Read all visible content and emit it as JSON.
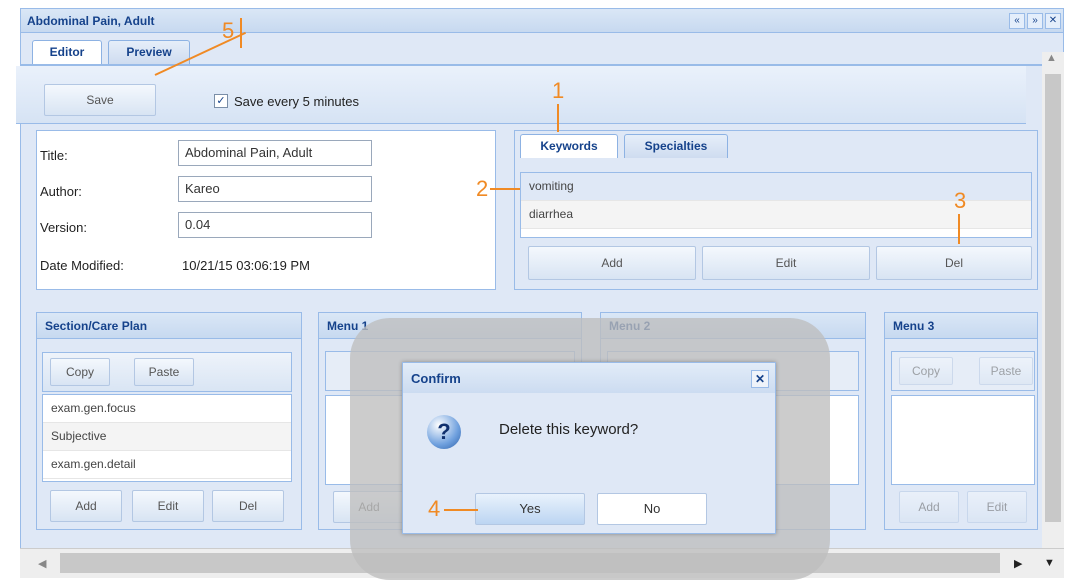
{
  "window": {
    "title": "Abdominal Pain, Adult",
    "tools": [
      "«",
      "»",
      "✕"
    ]
  },
  "tabs": [
    {
      "label": "Editor"
    },
    {
      "label": "Preview"
    }
  ],
  "toolbar": {
    "save_label": "Save",
    "autosave_label": "Save every 5 minutes",
    "autosave_checked": true
  },
  "fields": {
    "title_label": "Title:",
    "title_value": "Abdominal Pain, Adult",
    "author_label": "Author:",
    "author_value": "Kareo",
    "version_label": "Version:",
    "version_value": "0.04",
    "date_label": "Date Modified:",
    "date_value": "10/21/15 03:06:19 PM"
  },
  "keywords": {
    "tabs": [
      "Keywords",
      "Specialties"
    ],
    "items": [
      "vomiting",
      "diarrhea"
    ],
    "buttons": [
      "Add",
      "Edit",
      "Del"
    ]
  },
  "sections": [
    {
      "title": "Section/Care Plan",
      "copy": "Copy",
      "paste": "Paste",
      "items": [
        "exam.gen.focus",
        "Subjective",
        "exam.gen.detail"
      ],
      "buttons": [
        "Add",
        "Edit",
        "Del"
      ]
    },
    {
      "title": "Menu 1",
      "buttons": [
        "Add"
      ]
    },
    {
      "title": "Menu 2"
    },
    {
      "title": "Menu 3",
      "copy": "Copy",
      "paste": "Paste",
      "buttons": [
        "Add",
        "Edit"
      ]
    }
  ],
  "dialog": {
    "title": "Confirm",
    "message": "Delete this keyword?",
    "yes_label": "Yes",
    "no_label": "No",
    "close": "✕",
    "icon": "?"
  },
  "annotations": [
    "1",
    "2",
    "3",
    "4",
    "5"
  ],
  "scroll": {
    "up": "▲",
    "down": "▼",
    "left": "◀",
    "right": "▶"
  },
  "colors": {
    "accent": "#15428b",
    "border": "#99bbe8",
    "annotation": "#f08a24"
  }
}
